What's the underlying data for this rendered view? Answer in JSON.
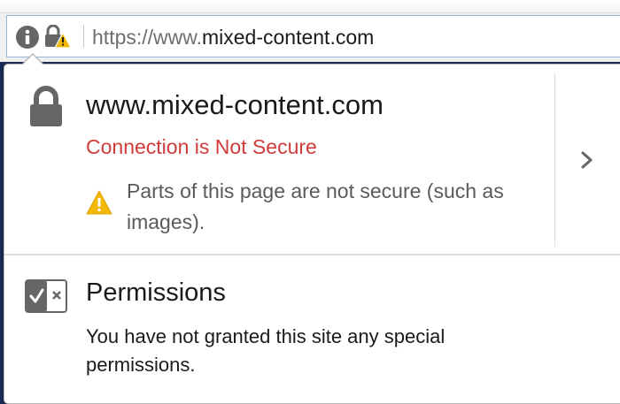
{
  "urlbar": {
    "prefix": "https://www.",
    "host": "mixed-content.com"
  },
  "popup": {
    "host": "www.mixed-content.com",
    "connection_status": "Connection is Not Secure",
    "mixed_content_message": "Parts of this page are not secure (such as images).",
    "permissions": {
      "title": "Permissions",
      "description": "You have not granted this site any special permissions."
    }
  },
  "colors": {
    "insecure_red": "#d03b3b",
    "warning_yellow": "#f2b705",
    "icon_gray": "#666666",
    "urlbar_border": "#9cb4d8"
  },
  "icons": {
    "identity": "info-icon",
    "connection": "lock-warning-icon",
    "security": "lock-icon",
    "warning": "warning-icon",
    "expand": "chevron-right-icon",
    "permissions": "permissions-icon"
  }
}
